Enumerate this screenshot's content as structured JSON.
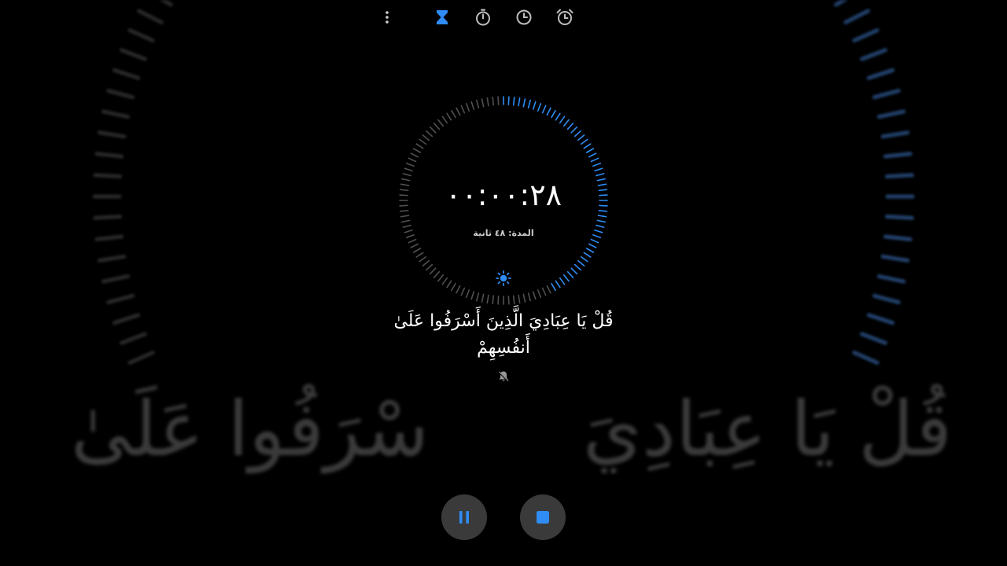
{
  "timer": {
    "readout": "٠٠:٠٠:٢٨",
    "duration_label": "المدة: ٤٨ ثانية",
    "progress_fraction": 0.42
  },
  "subtitle": {
    "line1": "قُلْ يَا عِبَادِيَ الَّذِينَ أَسْرَفُوا عَلَىٰ",
    "line2": "أَنفُسِهِمْ"
  },
  "background_text": {
    "left": "سْرَفُوا عَلَىٰ",
    "right": "قُلْ يَا عِبَادِيَ"
  },
  "topbar": {
    "icons": [
      "more-vert-icon",
      "hourglass-icon",
      "stopwatch-icon",
      "clock-icon",
      "alarm-icon"
    ]
  },
  "colors": {
    "accent": "#2f8cf5",
    "background": "#000000",
    "button_bg": "#3a3a3a",
    "tick_inactive": "#6b6b6b"
  }
}
